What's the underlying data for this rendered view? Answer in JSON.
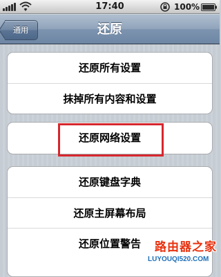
{
  "status_bar": {
    "time": "17:40",
    "battery_text": "100%",
    "icons": [
      "signal-icon",
      "wifi-icon",
      "rotation-lock-icon",
      "battery-icon"
    ]
  },
  "nav": {
    "back_label": "通用",
    "title": "还原"
  },
  "groups": [
    {
      "items": [
        "还原所有设置",
        "抹掉所有内容和设置"
      ]
    },
    {
      "items": [
        "还原网络设置"
      ]
    },
    {
      "items": [
        "还原键盘字典",
        "还原主屏幕布局",
        "还原位置警告"
      ]
    }
  ],
  "highlight": {
    "target": "还原网络设置",
    "color": "#d7262e"
  },
  "watermark": {
    "title": "路由器之家",
    "url": "LUYOUQI520.COM"
  },
  "colors": {
    "nav_bar": "#7d94af",
    "background": "#c5ccd4",
    "highlight": "#d7262e",
    "watermark_red": "#e8320f",
    "watermark_blue": "#1d6fb8"
  }
}
